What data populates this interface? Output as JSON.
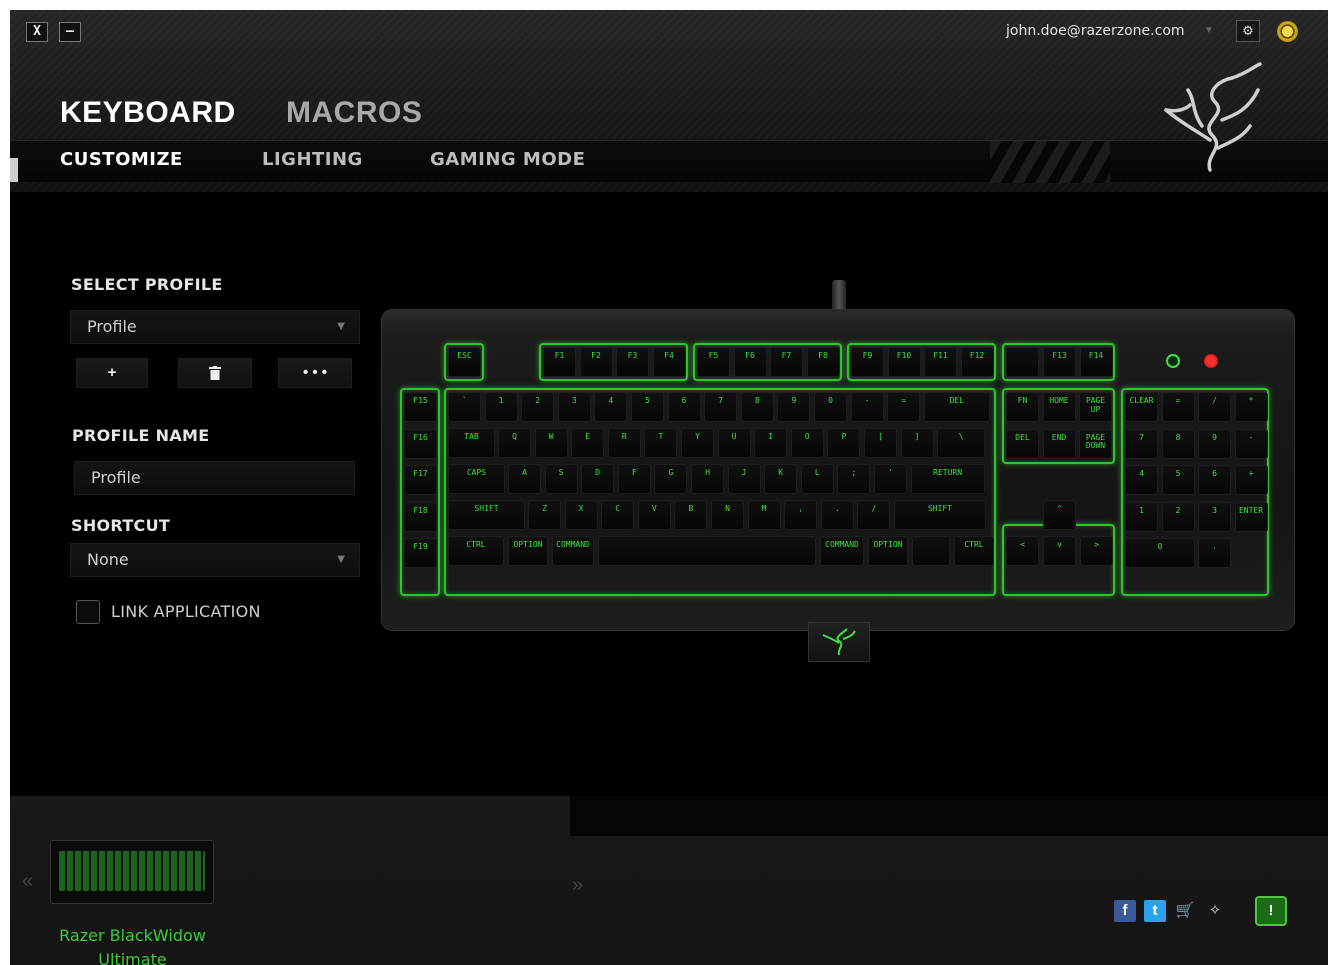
{
  "window": {
    "close_label": "X",
    "minimize_label": "–"
  },
  "header": {
    "email": "john.doe@razerzone.com",
    "tabs": {
      "keyboard": "KEYBOARD",
      "macros": "MACROS"
    },
    "subtabs": {
      "customize": "CUSTOMIZE",
      "lighting": "LIGHTING",
      "gaming_mode": "GAMING MODE"
    },
    "status_color": "#f0cc2a"
  },
  "left_panel": {
    "select_profile_label": "SELECT PROFILE",
    "profile_dropdown_value": "Profile",
    "add_button": "+",
    "delete_icon": "trash-icon",
    "more_button": "• • •",
    "profile_name_label": "PROFILE NAME",
    "profile_name_value": "Profile",
    "shortcut_label": "SHORTCUT",
    "shortcut_value": "None",
    "link_application_label": "LINK APPLICATION"
  },
  "keyboard": {
    "accent_color": "#33cc33",
    "esc": "ESC",
    "fkeys": [
      "F1",
      "F2",
      "F3",
      "F4",
      "F5",
      "F6",
      "F7",
      "F8",
      "F9",
      "F10",
      "F11",
      "F12"
    ],
    "fn_extra": [
      "F13",
      "F14"
    ],
    "macro_keys": [
      "F15",
      "F16",
      "F17",
      "F18",
      "F19"
    ],
    "number_row": [
      "`",
      "1",
      "2",
      "3",
      "4",
      "5",
      "6",
      "7",
      "8",
      "9",
      "0",
      "-",
      "=",
      "DEL"
    ],
    "qwerty_row": [
      "TAB",
      "Q",
      "W",
      "E",
      "R",
      "T",
      "Y",
      "U",
      "I",
      "O",
      "P",
      "[",
      "]",
      "\\"
    ],
    "home_row": [
      "CAPS",
      "A",
      "S",
      "D",
      "F",
      "G",
      "H",
      "J",
      "K",
      "L",
      ";",
      "'",
      "RETURN"
    ],
    "shift_row": [
      "SHIFT",
      "Z",
      "X",
      "C",
      "V",
      "B",
      "N",
      "M",
      ",",
      ".",
      "/",
      "SHIFT"
    ],
    "bottom_row": [
      "CTRL",
      "OPTION",
      "COMMAND",
      "",
      "COMMAND",
      "OPTION",
      "",
      "CTRL"
    ],
    "nav_keys": [
      "FN",
      "HOME",
      "PAGE UP",
      "DEL",
      "END",
      "PAGE DOWN"
    ],
    "arrow_keys": [
      "^",
      "<",
      "v",
      ">"
    ],
    "numpad": [
      "CLEAR",
      "=",
      "/",
      "*",
      "7",
      "8",
      "9",
      "-",
      "4",
      "5",
      "6",
      "+",
      "1",
      "2",
      "3",
      "ENTER",
      "0",
      "."
    ]
  },
  "footer": {
    "device_name": "Razer BlackWidow Ultimate",
    "prev_arrow": "«",
    "next_arrow": "»",
    "alert_label": "!",
    "social_icons": [
      "facebook-icon",
      "twitter-icon",
      "store-icon",
      "razer-icon"
    ]
  }
}
